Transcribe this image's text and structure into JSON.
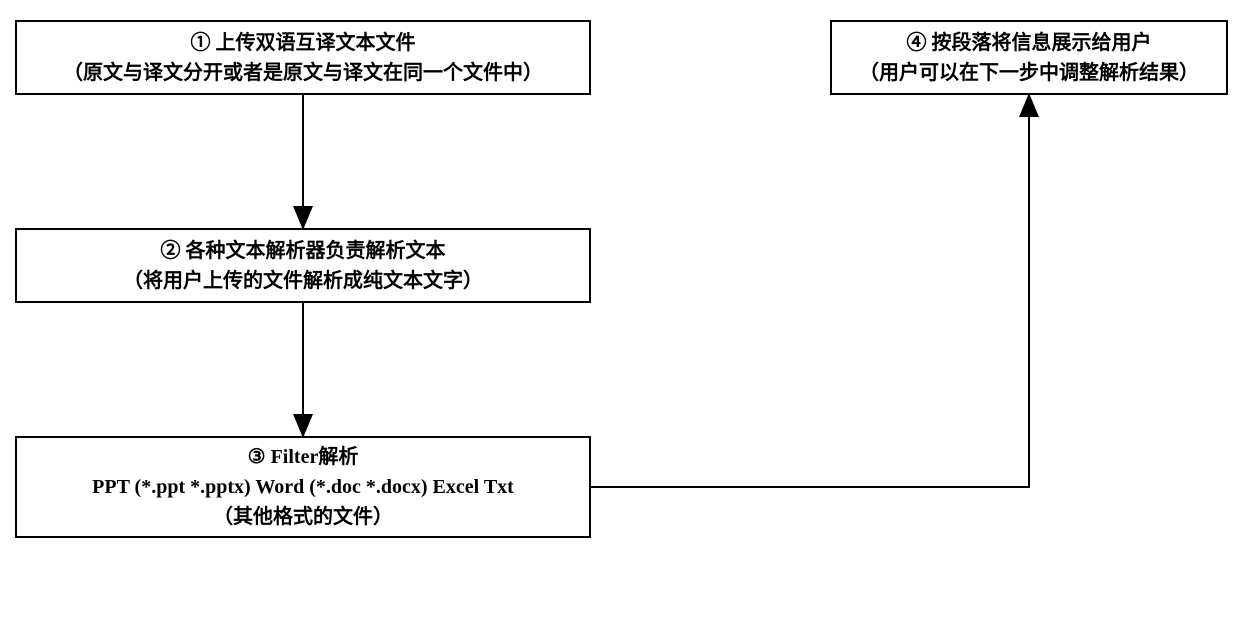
{
  "boxes": {
    "step1": {
      "line1": "① 上传双语互译文本文件",
      "line2": "（原文与译文分开或者是原文与译文在同一个文件中）"
    },
    "step2": {
      "line1": "② 各种文本解析器负责解析文本",
      "line2": "（将用户上传的文件解析成纯文本文字）"
    },
    "step3": {
      "line1": "③ Filter解析",
      "line2": "PPT (*.ppt *.pptx) Word (*.doc *.docx) Excel Txt",
      "line3": "（其他格式的文件）"
    },
    "step4": {
      "line1": "④ 按段落将信息展示给用户",
      "line2": "（用户可以在下一步中调整解析结果）"
    }
  }
}
